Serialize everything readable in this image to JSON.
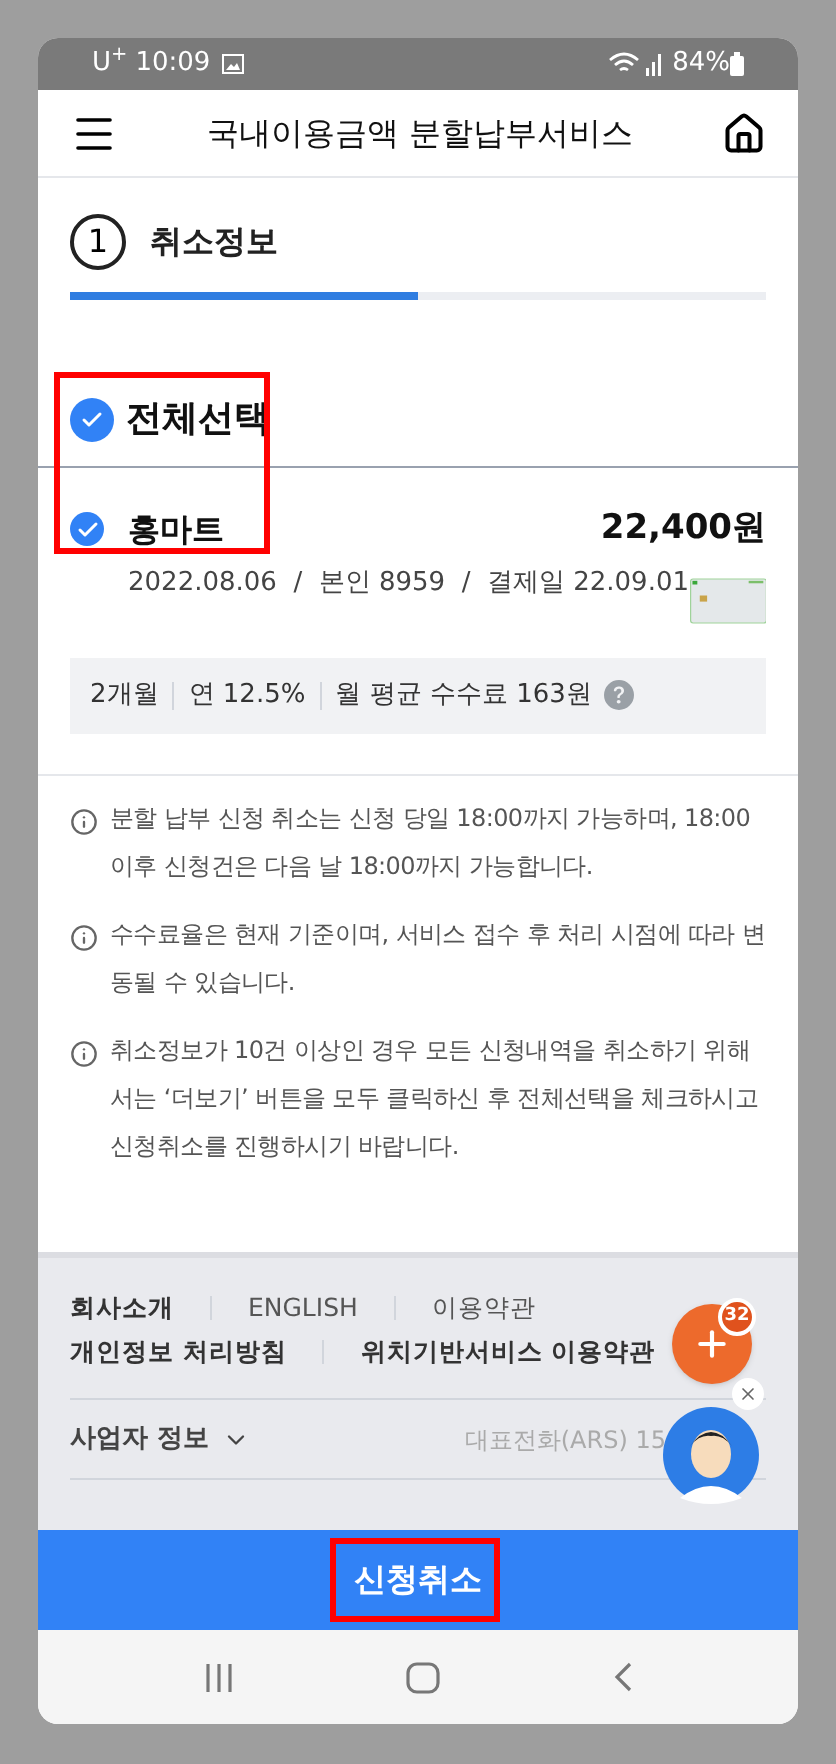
{
  "status_bar": {
    "carrier": "U$^{+}$",
    "time": "10:09",
    "battery": "84%"
  },
  "header": {
    "title": "국내이용금액 분할납부서비스"
  },
  "step": {
    "number": "1",
    "title": "취소정보",
    "level": 0.5
  },
  "select_all": {
    "label": "전체선택",
    "checked": true
  },
  "items": [
    {
      "merchant": "홍마트",
      "checked": true,
      "amount": "22,400원",
      "details": "2022.08.06  /  본인 8959  /  결제일 22.09.01",
      "terms": [
        "2개월",
        "연 12.5%",
        "월 평균 수수료 163원"
      ]
    }
  ],
  "notices": [
    "분할 납부 신청 취소는 신청 당일 18:00까지 가능하며, 18:00 이후 신청건은 다음 날 18:00까지 가능합니다.",
    "수수료율은 현재 기준이며, 서비스 접수 후 처리 시점에 따라 변동될 수 있습니다.",
    "취소정보가 10건 이상인 경우 모든 신청내역을 취소하기 위해서는 ‘더보기’ 버튼을 모두 클릭하신 후 전체선택을 체크하시고 신청취소를 진행하시기 바랍니다."
  ],
  "footer": {
    "link_rows": [
      [
        {
          "label": "회사소개",
          "bold": true
        },
        {
          "label": "ENGLISH",
          "bold": false
        },
        {
          "label": "이용약관",
          "bold": false
        }
      ],
      [
        {
          "label": "개인정보 처리방침",
          "bold": true
        },
        {
          "label": "위치기반서비스 이용약관",
          "bold": true
        }
      ]
    ],
    "business_info": "사업자 정보",
    "phone": "대표전화(ARS) 15"
  },
  "fab": {
    "badge": "32"
  },
  "submit": "신청취소"
}
